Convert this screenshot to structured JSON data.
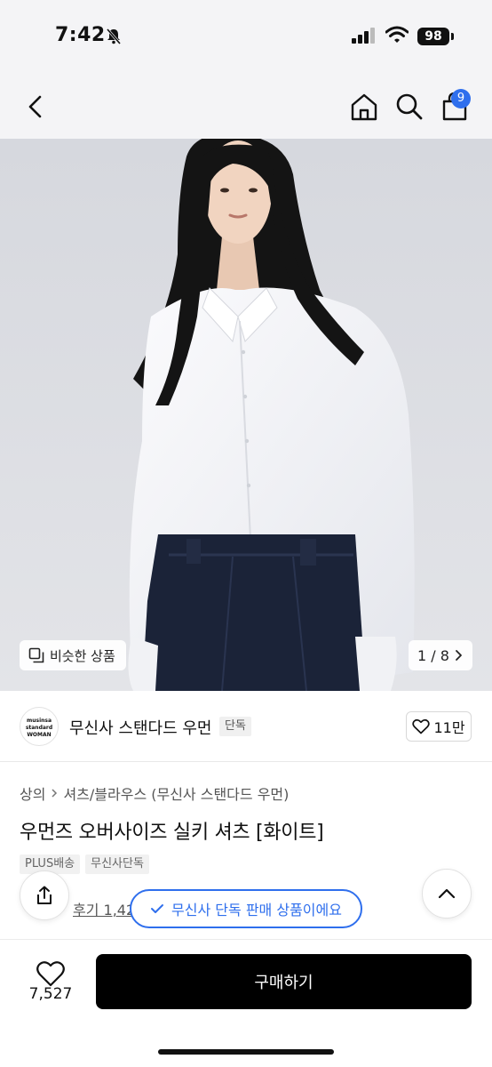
{
  "status_bar": {
    "time": "7:42",
    "battery": "98"
  },
  "nav": {
    "cart_badge": "9"
  },
  "gallery": {
    "similar_label": "비슷한 상품",
    "page_counter": "1 / 8"
  },
  "brand": {
    "logo_line1": "musinsa",
    "logo_line2": "standard",
    "logo_line3": "WOMAN",
    "name": "무신사 스탠다드 우먼",
    "tag": "단독",
    "likes": "11만"
  },
  "product": {
    "breadcrumb_1": "상의",
    "breadcrumb_2": "셔츠/블라우스 (무신사 스탠다드 우먼)",
    "title": "우먼즈 오버사이즈 실키 셔츠 [화이트]",
    "tags": [
      "PLUS배송",
      "무신사단독"
    ],
    "review_label": "후기 1,42",
    "exclusive_notice": "무신사 단독 판매 상품이에요"
  },
  "bottom": {
    "like_count": "7,527",
    "buy_label": "구매하기"
  },
  "colors": {
    "accent": "#2f6fed",
    "primary_button": "#000000",
    "nav_background": "#f4f4f6"
  }
}
